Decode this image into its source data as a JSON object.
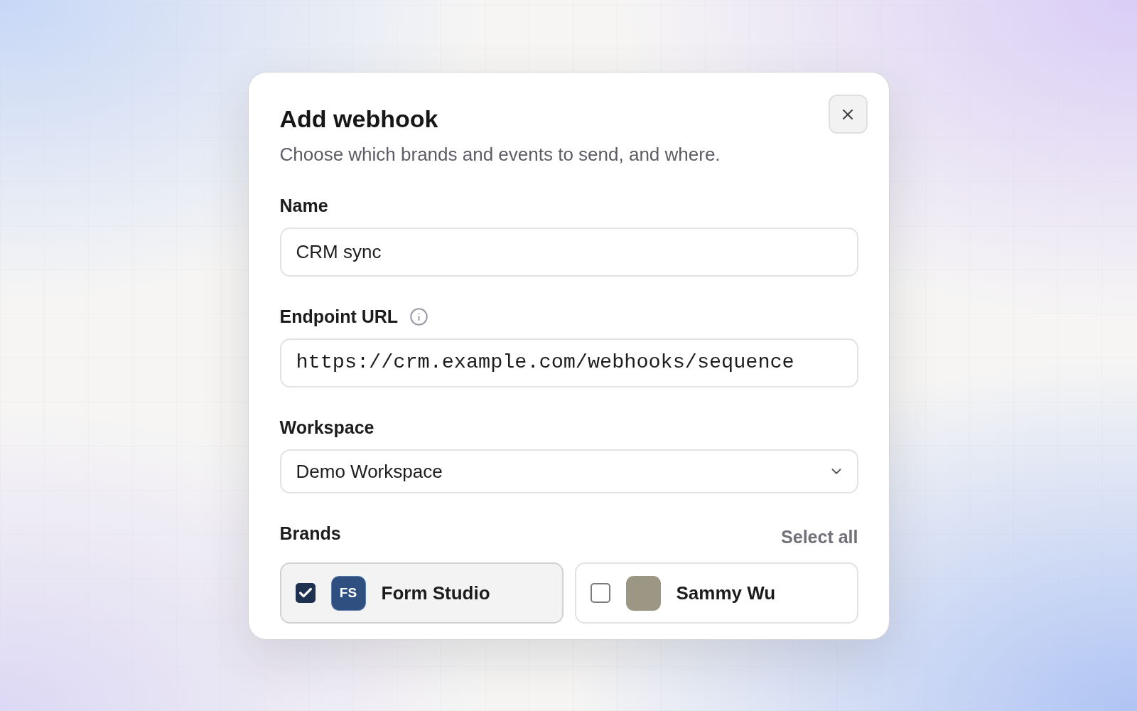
{
  "dialog": {
    "title": "Add webhook",
    "subtitle": "Choose which brands and events to send, and where."
  },
  "fields": [
    {
      "kind": "text",
      "label": "Name",
      "info": false,
      "value": "CRM sync"
    },
    {
      "kind": "url",
      "label": "Endpoint URL",
      "info": true,
      "value": "https://crm.example.com/webhooks/sequence"
    },
    {
      "kind": "select",
      "label": "Workspace",
      "info": false,
      "value": "Demo Workspace"
    }
  ],
  "brands": {
    "label": "Brands",
    "select_all": "Select all",
    "items": [
      {
        "name": "Form Studio",
        "checked": true,
        "avatar": {
          "kind": "initials",
          "text": "FS"
        }
      },
      {
        "name": "Sammy Wu",
        "checked": false,
        "avatar": {
          "kind": "photo"
        }
      }
    ]
  }
}
